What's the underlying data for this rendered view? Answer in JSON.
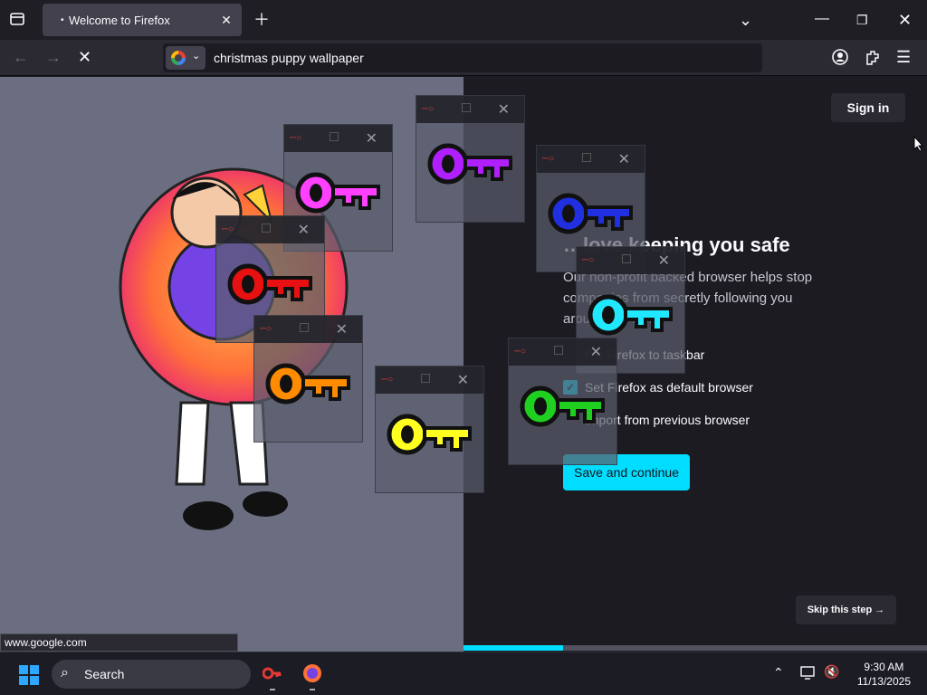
{
  "tabs": {
    "active_title": "Welcome to Firefox",
    "loading_dot": "•"
  },
  "urlbar": {
    "value": "christmas puppy wallpaper",
    "engine": "Google"
  },
  "page": {
    "sign_in": "Sign in",
    "heading": "…love keeping you safe",
    "paragraph": "Our non-profit backed browser helps stop companies from secretly following you around the web.",
    "option_taskbar": "Pin Firefox to taskbar",
    "option_default": "Set Firefox as default browser",
    "option_import": "Import from previous browser",
    "save_button": "Save and continue",
    "skip_button": "Skip this step →",
    "progress_fraction": 0.215
  },
  "status_bar": "www.google.com",
  "key_windows": [
    {
      "color": "#ff40ff"
    },
    {
      "color": "#b020ff"
    },
    {
      "color": "#2030e0"
    },
    {
      "color": "#e81010"
    },
    {
      "color": "#20e8ff"
    },
    {
      "color": "#ff8c00"
    },
    {
      "color": "#ffff20"
    },
    {
      "color": "#20d020"
    }
  ],
  "taskbar": {
    "search": "Search",
    "time": "9:30 AM",
    "date": "11/13/2025"
  },
  "colors": {
    "accent": "#00ddff",
    "chrome": "#2b2a33"
  }
}
